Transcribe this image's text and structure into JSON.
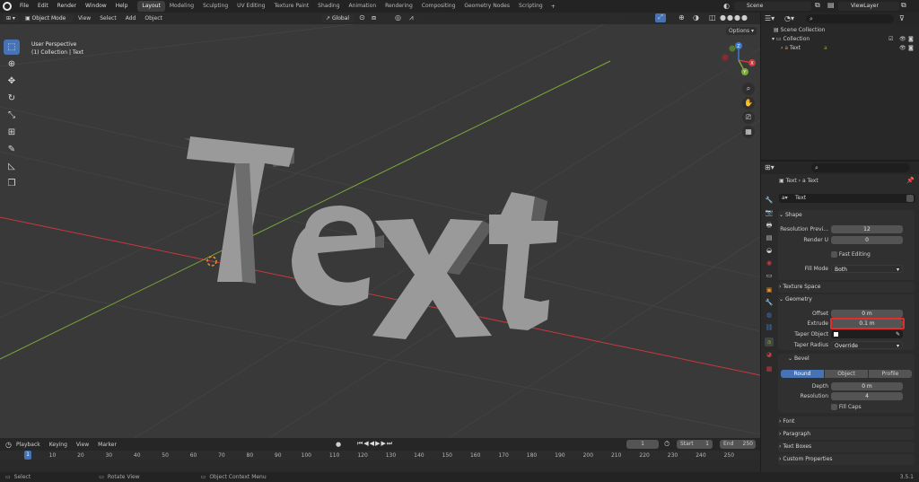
{
  "menu": [
    "File",
    "Edit",
    "Render",
    "Window",
    "Help"
  ],
  "workspaces": [
    "Layout",
    "Modeling",
    "Sculpting",
    "UV Editing",
    "Texture Paint",
    "Shading",
    "Animation",
    "Rendering",
    "Compositing",
    "Geometry Nodes",
    "Scripting"
  ],
  "active_workspace": "Layout",
  "scene_name": "Scene",
  "view_layer": "ViewLayer",
  "viewport": {
    "mode": "Object Mode",
    "menus": [
      "View",
      "Select",
      "Add",
      "Object"
    ],
    "orientation": "Global",
    "options_label": "Options",
    "overlay_title": "User Perspective",
    "overlay_subtitle": "(1) Collection | Text",
    "gizmo": {
      "x": "X",
      "y": "Y",
      "z": "Z"
    },
    "text_object": "Text"
  },
  "outliner": {
    "root": "Scene Collection",
    "collection": "Collection",
    "object": "Text"
  },
  "properties": {
    "breadcrumb_object": "Text",
    "breadcrumb_data": "Text",
    "datablock_name": "Text",
    "sections": {
      "shape": "Shape",
      "texture_space": "Texture Space",
      "geometry": "Geometry",
      "bevel": "Bevel",
      "font": "Font",
      "paragraph": "Paragraph",
      "text_boxes": "Text Boxes",
      "custom_properties": "Custom Properties"
    },
    "shape": {
      "resolution_preview_label": "Resolution Previ...",
      "resolution_preview_value": "12",
      "render_u_label": "Render U",
      "render_u_value": "0",
      "fast_editing_label": "Fast Editing",
      "fill_mode_label": "Fill Mode",
      "fill_mode_value": "Both"
    },
    "geometry": {
      "offset_label": "Offset",
      "offset_value": "0 m",
      "extrude_label": "Extrude",
      "extrude_value": "0.1 m",
      "taper_object_label": "Taper Object",
      "taper_radius_label": "Taper Radius",
      "taper_radius_value": "Override"
    },
    "bevel": {
      "modes": [
        "Round",
        "Object",
        "Profile"
      ],
      "active_mode": "Round",
      "depth_label": "Depth",
      "depth_value": "0 m",
      "resolution_label": "Resolution",
      "resolution_value": "4",
      "fill_caps_label": "Fill Caps"
    }
  },
  "timeline": {
    "menus": [
      "Playback",
      "Keying",
      "View",
      "Marker"
    ],
    "current_frame": "1",
    "start_label": "Start",
    "start_value": "1",
    "end_label": "End",
    "end_value": "250",
    "ruler": [
      "1",
      "10",
      "20",
      "30",
      "40",
      "50",
      "60",
      "70",
      "80",
      "90",
      "100",
      "110",
      "120",
      "130",
      "140",
      "150",
      "160",
      "170",
      "180",
      "190",
      "200",
      "210",
      "220",
      "230",
      "240",
      "250"
    ]
  },
  "status": {
    "select": "Select",
    "rotate": "Rotate View",
    "context": "Object Context Menu",
    "version": "3.5.1"
  },
  "colors": {
    "accent": "#4772b3",
    "x_axis": "#c8393f",
    "y_axis": "#7ba93a",
    "z_axis": "#3c78c9",
    "highlight_box": "#e32c2c"
  }
}
